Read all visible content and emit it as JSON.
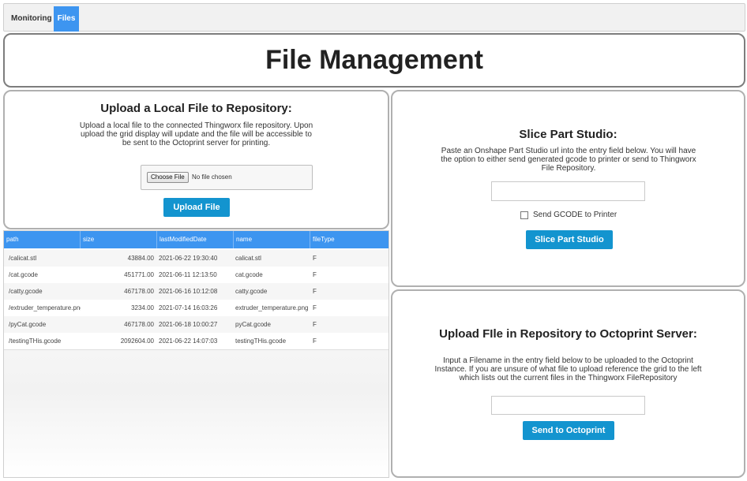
{
  "tabs": [
    {
      "label": "Monitoring",
      "active": false
    },
    {
      "label": "Files",
      "active": true
    }
  ],
  "header": {
    "title": "File Management"
  },
  "upload_local": {
    "title": "Upload a Local File to Repository:",
    "description": "Upload a local file to the connected Thingworx file repository. Upon upload the grid display will update and the file will be accessible to be sent to the Octoprint server for printing.",
    "choose_label": "Choose File",
    "no_file_text": "No file chosen",
    "button_label": "Upload File"
  },
  "grid": {
    "columns": [
      "path",
      "size",
      "lastModifiedDate",
      "name",
      "fileType"
    ],
    "rows": [
      [
        "/calicat.stl",
        "43884.00",
        "2021-06-22 19:30:40",
        "calicat.stl",
        "F"
      ],
      [
        "/cat.gcode",
        "451771.00",
        "2021-06-11 12:13:50",
        "cat.gcode",
        "F"
      ],
      [
        "/catty.gcode",
        "467178.00",
        "2021-06-16 10:12:08",
        "catty.gcode",
        "F"
      ],
      [
        "/extruder_temperature.png",
        "3234.00",
        "2021-07-14 16:03:26",
        "extruder_temperature.png",
        "F"
      ],
      [
        "/pyCat.gcode",
        "467178.00",
        "2021-06-18 10:00:27",
        "pyCat.gcode",
        "F"
      ],
      [
        "/testingTHis.gcode",
        "2092604.00",
        "2021-06-22 14:07:03",
        "testingTHis.gcode",
        "F"
      ]
    ]
  },
  "slice": {
    "title": "Slice Part Studio:",
    "description": "Paste an Onshape Part Studio url into the entry field below. You will have the option to either send generated gcode to printer or send to Thingworx File Repository.",
    "url_value": "",
    "checkbox_label": "Send GCODE to Printer",
    "checkbox_checked": false,
    "button_label": "Slice Part Studio"
  },
  "octoprint": {
    "title": "Upload FIle in Repository to Octoprint Server:",
    "description": "Input a Filename in the entry field below to be uploaded to the Octoprint Instance. If you are unsure of what file to upload reference the grid to the left which lists out the current files in the Thingworx FileRepository",
    "filename_value": "",
    "button_label": "Send to Octoprint"
  },
  "colors": {
    "accent": "#3d95f0",
    "button": "#1394cf"
  }
}
